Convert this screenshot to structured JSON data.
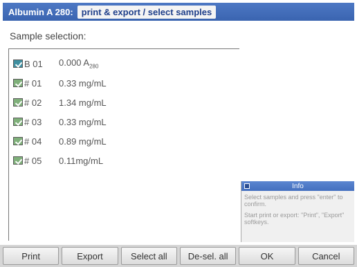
{
  "header": {
    "app": "Albumin A 280:",
    "subtitle": "print & export / select samples"
  },
  "section_label": "Sample selection:",
  "samples": [
    {
      "id": "B 01",
      "value": "0.000 A",
      "subscript": "280",
      "checked": true,
      "kind": "blank"
    },
    {
      "id": "# 01",
      "value": "0.33 mg/mL",
      "checked": true,
      "kind": "sample"
    },
    {
      "id": "# 02",
      "value": "1.34 mg/mL",
      "checked": true,
      "kind": "sample"
    },
    {
      "id": "# 03",
      "value": "0.33 mg/mL",
      "checked": true,
      "kind": "sample"
    },
    {
      "id": "# 04",
      "value": "0.89 mg/mL",
      "checked": true,
      "kind": "sample"
    },
    {
      "id": "# 05",
      "value": "0.11mg/mL",
      "checked": true,
      "kind": "sample"
    }
  ],
  "info": {
    "title": "Info",
    "line1": "Select samples and press \"enter\" to confirm.",
    "line2": "Start print or export: \"Print\", \"Export\" softkeys."
  },
  "softkeys": [
    "Print",
    "Export",
    "Select all",
    "De-sel. all",
    "OK",
    "Cancel"
  ],
  "colors": {
    "title_bar": "#3a64b0",
    "checkbox_sample": "#7fb07a",
    "checkbox_blank": "#3f8fa0"
  }
}
